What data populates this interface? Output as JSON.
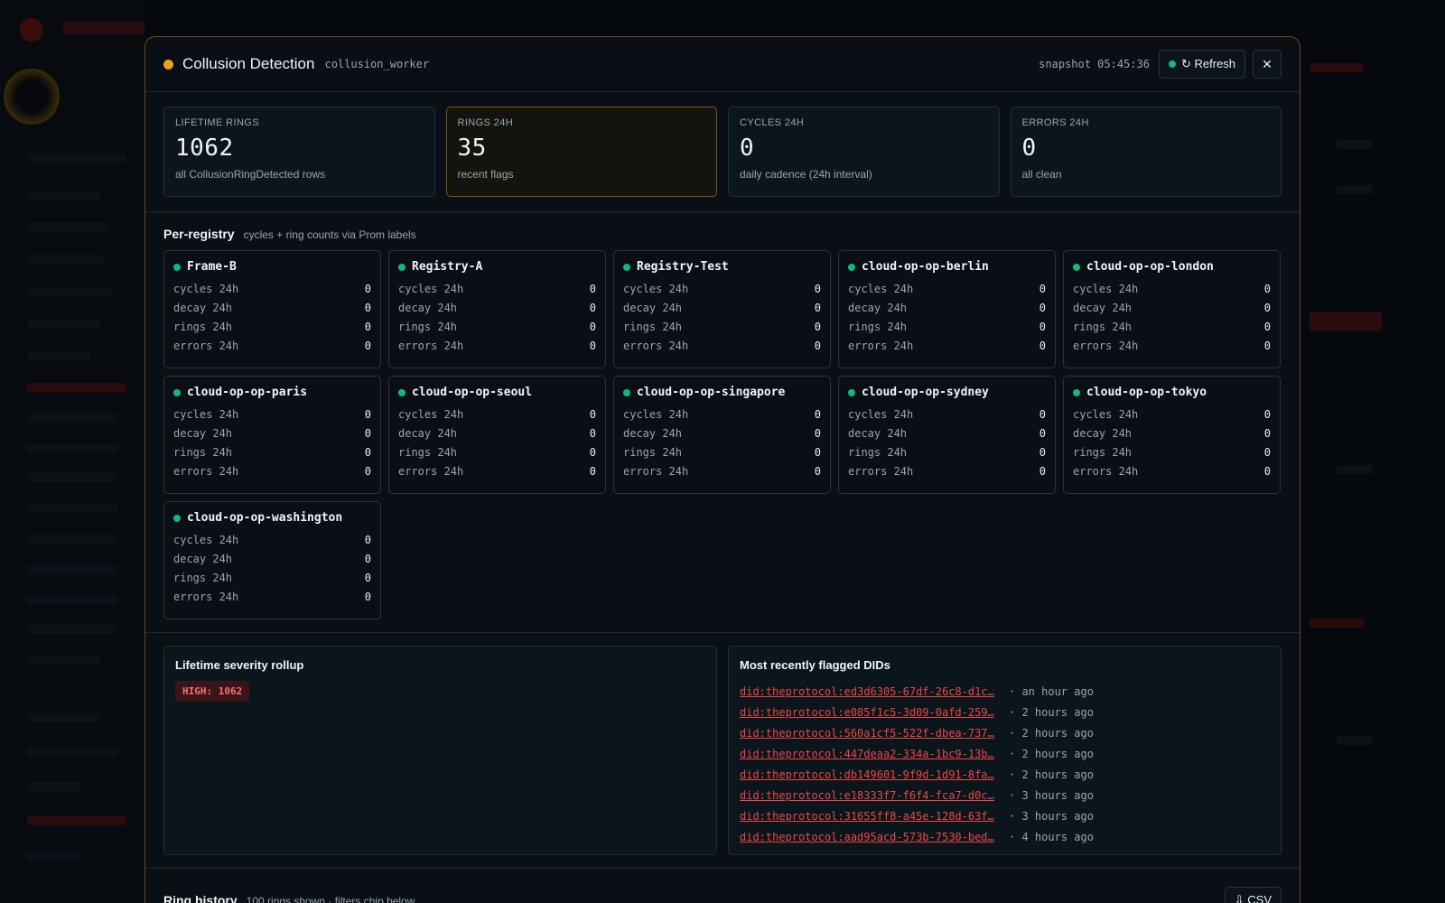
{
  "modal": {
    "title": "Collusion Detection",
    "worker": "collusion_worker",
    "snapshot": "snapshot 05:45:36",
    "refresh_label": "↻ Refresh",
    "close_label": "✕"
  },
  "kpis": [
    {
      "label": "LIFETIME RINGS",
      "value": "1062",
      "sub": "all CollusionRingDetected rows"
    },
    {
      "label": "RINGS 24H",
      "value": "35",
      "sub": "recent flags"
    },
    {
      "label": "CYCLES 24H",
      "value": "0",
      "sub": "daily cadence (24h interval)"
    },
    {
      "label": "ERRORS 24H",
      "value": "0",
      "sub": "all clean"
    }
  ],
  "per_registry": {
    "title": "Per-registry",
    "subtitle": "cycles + ring counts via Prom labels",
    "row_labels": [
      "cycles 24h",
      "decay 24h",
      "rings 24h",
      "errors 24h"
    ],
    "registries": [
      {
        "name": "Frame-B",
        "values": [
          "0",
          "0",
          "0",
          "0"
        ]
      },
      {
        "name": "Registry-A",
        "values": [
          "0",
          "0",
          "0",
          "0"
        ]
      },
      {
        "name": "Registry-Test",
        "values": [
          "0",
          "0",
          "0",
          "0"
        ]
      },
      {
        "name": "cloud-op-op-berlin",
        "values": [
          "0",
          "0",
          "0",
          "0"
        ]
      },
      {
        "name": "cloud-op-op-london",
        "values": [
          "0",
          "0",
          "0",
          "0"
        ]
      },
      {
        "name": "cloud-op-op-paris",
        "values": [
          "0",
          "0",
          "0",
          "0"
        ]
      },
      {
        "name": "cloud-op-op-seoul",
        "values": [
          "0",
          "0",
          "0",
          "0"
        ]
      },
      {
        "name": "cloud-op-op-singapore",
        "values": [
          "0",
          "0",
          "0",
          "0"
        ]
      },
      {
        "name": "cloud-op-op-sydney",
        "values": [
          "0",
          "0",
          "0",
          "0"
        ]
      },
      {
        "name": "cloud-op-op-tokyo",
        "values": [
          "0",
          "0",
          "0",
          "0"
        ]
      },
      {
        "name": "cloud-op-op-washington",
        "values": [
          "0",
          "0",
          "0",
          "0"
        ]
      }
    ]
  },
  "severity": {
    "title": "Lifetime severity rollup",
    "badge": "HIGH: 1062"
  },
  "flagged": {
    "title": "Most recently flagged DIDs",
    "items": [
      {
        "did": "did:theprotocol:ed3d6305-67df-26c8-d1c…",
        "time": "· an hour ago"
      },
      {
        "did": "did:theprotocol:e085f1c5-3d09-0afd-259…",
        "time": "· 2 hours ago"
      },
      {
        "did": "did:theprotocol:560a1cf5-522f-dbea-737…",
        "time": "· 2 hours ago"
      },
      {
        "did": "did:theprotocol:447deaa2-334a-1bc9-13b…",
        "time": "· 2 hours ago"
      },
      {
        "did": "did:theprotocol:db149601-9f9d-1d91-8fa…",
        "time": "· 2 hours ago"
      },
      {
        "did": "did:theprotocol:e18333f7-f6f4-fca7-d0c…",
        "time": "· 3 hours ago"
      },
      {
        "did": "did:theprotocol:31655ff8-a45e-128d-63f…",
        "time": "· 3 hours ago"
      },
      {
        "did": "did:theprotocol:aad95acd-573b-7530-bed…",
        "time": "· 4 hours ago"
      }
    ]
  },
  "history": {
    "title": "Ring history",
    "subtitle": "100 rings shown · filters chip below",
    "csv_label": "⇩ CSV"
  },
  "colors": {
    "accent_warning": "#f59e0b",
    "ok": "#10b981",
    "danger": "#ef4444"
  }
}
